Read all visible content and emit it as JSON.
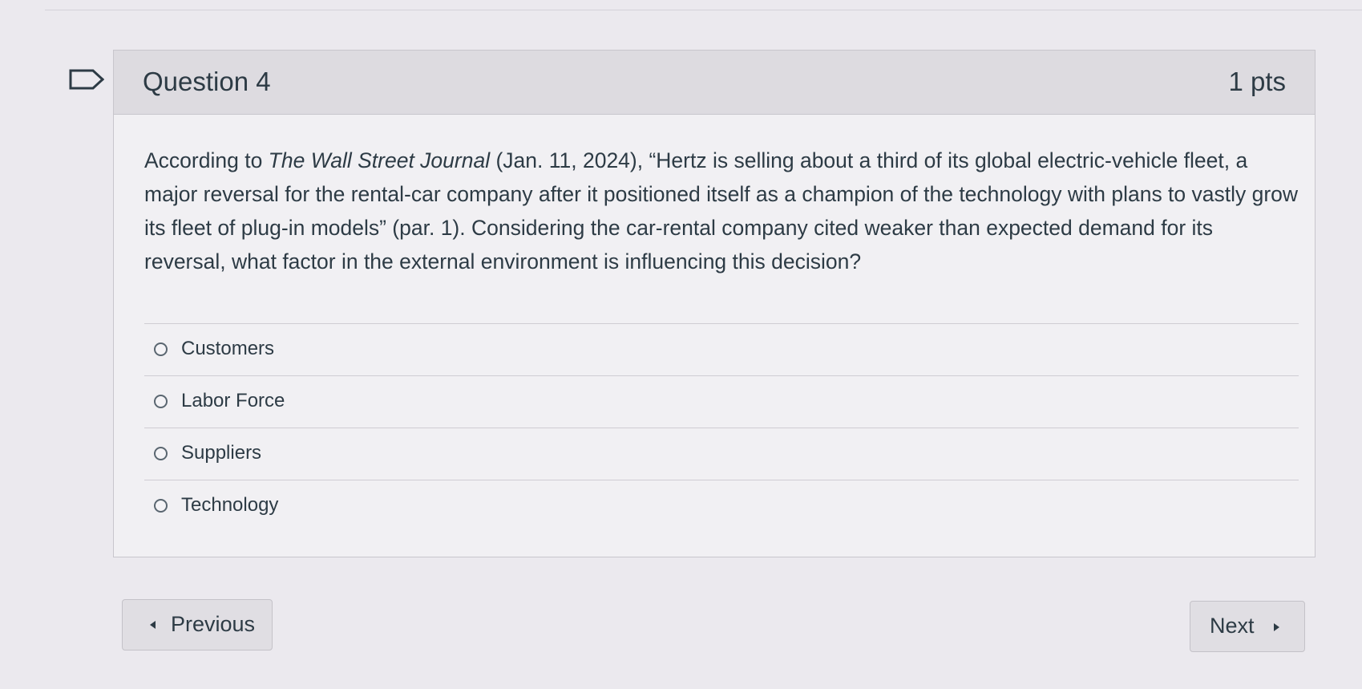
{
  "question": {
    "title": "Question 4",
    "points": "1 pts",
    "text_before_source": "According to ",
    "source_italic": "The Wall Street Journal",
    "text_after_source": " (Jan. 11, 2024), “Hertz is selling about a third of its global electric-vehicle fleet, a major reversal for the rental-car company after it positioned itself as a champion of the technology with plans to vastly grow its fleet of plug-in models” (par. 1). Considering the car-rental company cited weaker than expected demand for its reversal, what factor in the external environment is influencing this decision?",
    "flag_icon": "flag-outline-icon"
  },
  "answers": [
    {
      "label": "Customers",
      "selected": false
    },
    {
      "label": "Labor Force",
      "selected": false
    },
    {
      "label": "Suppliers",
      "selected": false
    },
    {
      "label": "Technology",
      "selected": false
    }
  ],
  "navigation": {
    "previous_label": "Previous",
    "next_label": "Next",
    "previous_icon": "caret-left-icon",
    "next_icon": "caret-right-icon"
  }
}
